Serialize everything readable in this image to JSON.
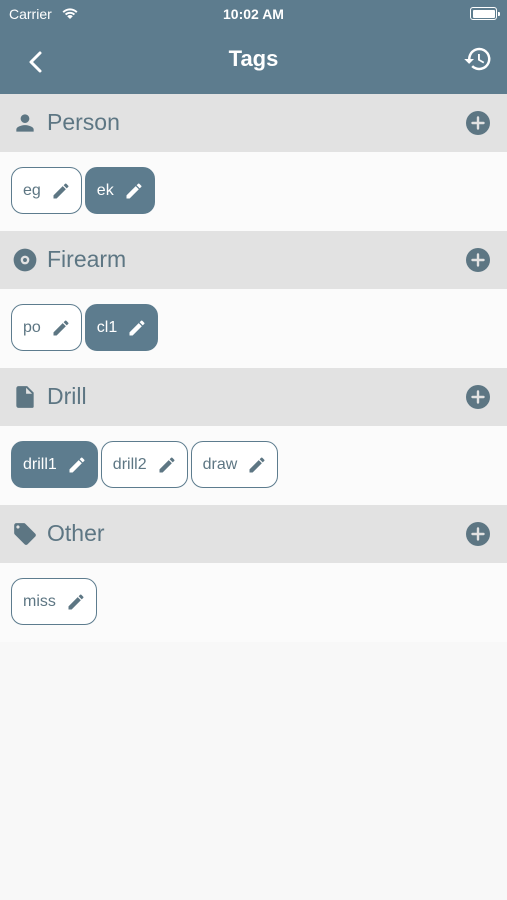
{
  "status_bar": {
    "carrier": "Carrier",
    "time": "10:02 AM"
  },
  "navbar": {
    "title": "Tags",
    "back_icon": "chevron-left-icon",
    "history_icon": "history-icon"
  },
  "colors": {
    "brand": "#5d7c8e",
    "section_header_bg": "#e2e2e2",
    "text_muted": "#5d7683"
  },
  "sections": [
    {
      "title": "Person",
      "icon": "person-icon",
      "tags": [
        {
          "label": "eg",
          "selected": false
        },
        {
          "label": "ek",
          "selected": true
        }
      ]
    },
    {
      "title": "Firearm",
      "icon": "disc-icon",
      "tags": [
        {
          "label": "po",
          "selected": false
        },
        {
          "label": "cl1",
          "selected": true
        }
      ]
    },
    {
      "title": "Drill",
      "icon": "document-icon",
      "tags": [
        {
          "label": "drill1",
          "selected": true
        },
        {
          "label": "drill2",
          "selected": false
        },
        {
          "label": "draw",
          "selected": false
        }
      ]
    },
    {
      "title": "Other",
      "icon": "tag-icon",
      "tags": [
        {
          "label": "miss",
          "selected": false
        }
      ]
    }
  ]
}
